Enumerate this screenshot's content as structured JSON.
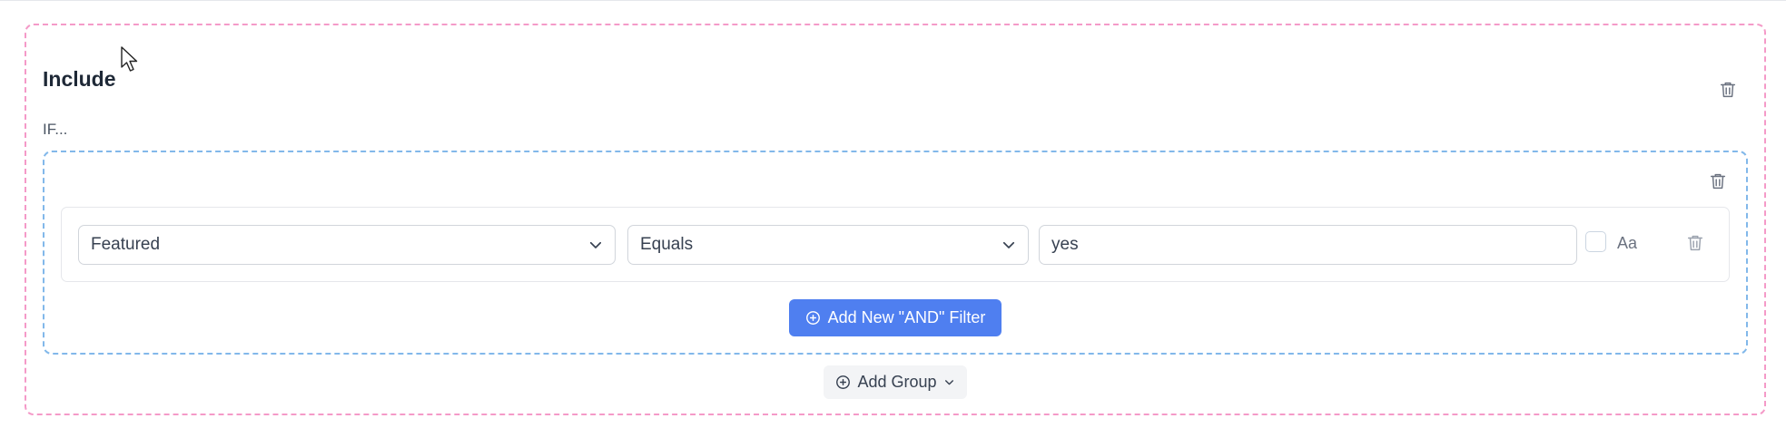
{
  "include_block": {
    "title": "Include",
    "condition_prefix": "IF...",
    "delete_icon": "trash-icon"
  },
  "group": {
    "delete_icon": "trash-icon",
    "filter": {
      "field_value": "Featured",
      "operator_value": "Equals",
      "value": "yes",
      "case_sensitive_checked": false,
      "case_sensitive_label": "Aa"
    },
    "add_and_filter_label": "Add New \"AND\" Filter"
  },
  "add_group_label": "Add Group",
  "colors": {
    "include_border": "#f49ac8",
    "group_border": "#82b8ea",
    "primary_button": "#4f7ff0",
    "secondary_button": "#f3f4f6"
  }
}
